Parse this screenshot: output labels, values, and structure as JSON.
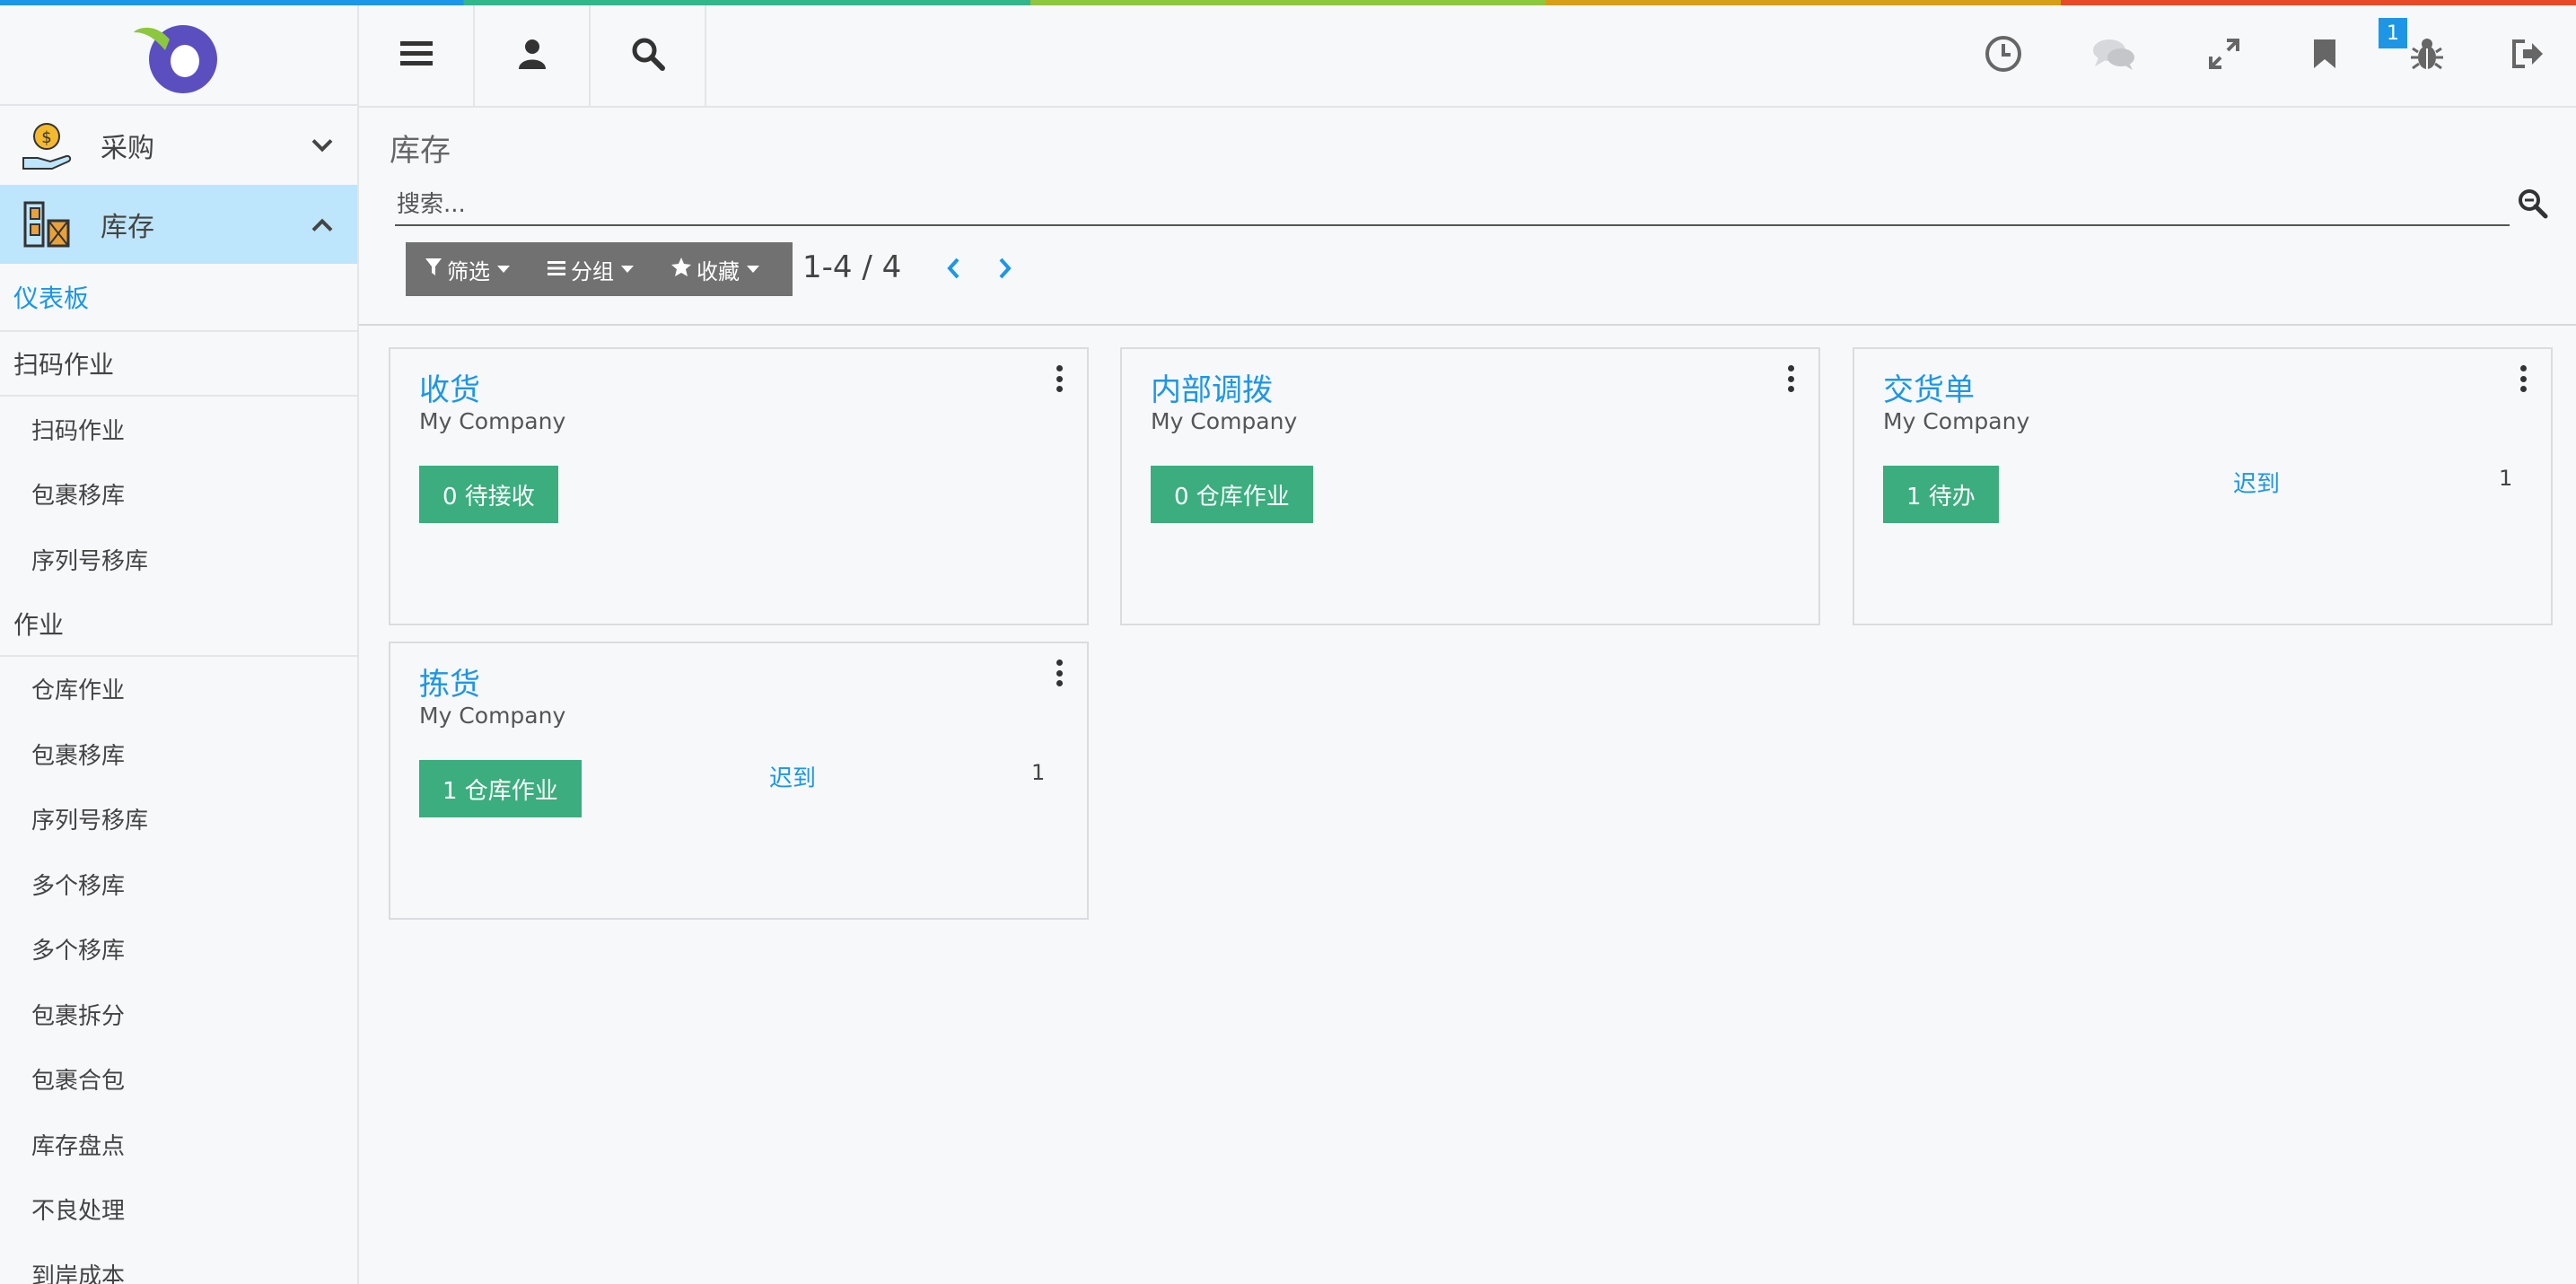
{
  "sidebar": {
    "apps": [
      {
        "label": "采购",
        "icon": "purchase-icon",
        "expanded": false
      },
      {
        "label": "库存",
        "icon": "inventory-icon",
        "expanded": true
      }
    ],
    "dashboard_link": "仪表板",
    "categories": [
      {
        "label": "扫码作业",
        "items": [
          "扫码作业",
          "包裹移库",
          "序列号移库"
        ]
      },
      {
        "label": "作业",
        "items": [
          "仓库作业",
          "包裹移库",
          "序列号移库",
          "多个移库",
          "多个移库",
          "包裹拆分",
          "包裹合包",
          "库存盘点",
          "不良处理",
          "到岸成本"
        ]
      }
    ]
  },
  "topbar": {
    "left_icons": [
      "menu-icon",
      "user-icon",
      "search-icon"
    ],
    "right_icons": [
      "clock-icon",
      "chat-icon",
      "expand-icon",
      "bookmark-icon",
      "bug-icon",
      "logout-icon"
    ],
    "activity_badge": "1"
  },
  "control": {
    "title": "库存",
    "search_placeholder": "搜索...",
    "filter_label": "筛选",
    "group_label": "分组",
    "favorite_label": "收藏",
    "pager_value": "1-4 / 4"
  },
  "cards": [
    {
      "title": "收货",
      "company": "My Company",
      "button": "0 待接收",
      "late_label": "",
      "late_count": ""
    },
    {
      "title": "内部调拨",
      "company": "My Company",
      "button": "0 仓库作业",
      "late_label": "",
      "late_count": ""
    },
    {
      "title": "交货单",
      "company": "My Company",
      "button": "1 待办",
      "late_label": "迟到",
      "late_count": "1"
    },
    {
      "title": "拣货",
      "company": "My Company",
      "button": "1 仓库作业",
      "late_label": "迟到",
      "late_count": "1"
    }
  ],
  "colors": {
    "accent": "#1d96e6",
    "button_green": "#3bad7e",
    "sidebar_active": "#bde5fb",
    "filter_bar": "#717171"
  }
}
